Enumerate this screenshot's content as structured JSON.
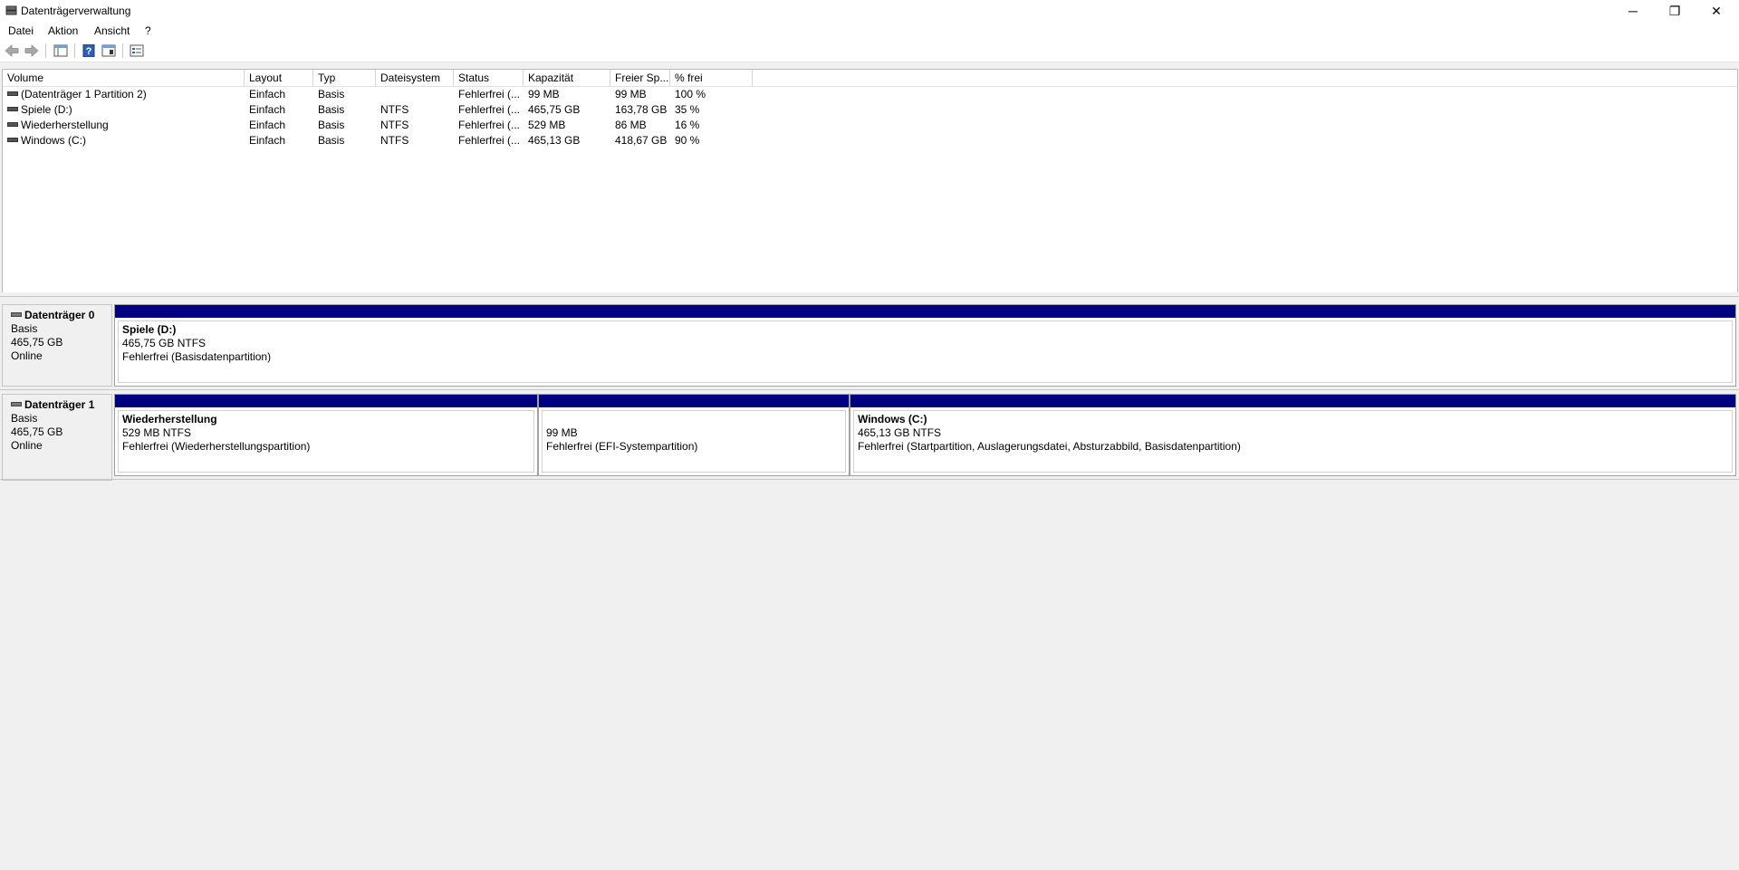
{
  "window": {
    "title": "Datenträgerverwaltung",
    "minimize_glyph": "─",
    "restore_glyph": "❐",
    "close_glyph": "✕"
  },
  "menu": [
    "Datei",
    "Aktion",
    "Ansicht",
    "?"
  ],
  "toolbar": {
    "icons": [
      "back-arrow-icon",
      "forward-arrow-icon",
      "console-tree-icon",
      "help-icon",
      "show-hide-icon",
      "properties-icon"
    ]
  },
  "volume_list": {
    "columns": [
      "Volume",
      "Layout",
      "Typ",
      "Dateisystem",
      "Status",
      "Kapazität",
      "Freier Sp...",
      "% frei"
    ],
    "rows": [
      [
        "(Datenträger 1 Partition 2)",
        "Einfach",
        "Basis",
        "",
        "Fehlerfrei (...",
        "99 MB",
        "99 MB",
        "100 %"
      ],
      [
        "Spiele (D:)",
        "Einfach",
        "Basis",
        "NTFS",
        "Fehlerfrei (...",
        "465,75 GB",
        "163,78 GB",
        "35 %"
      ],
      [
        "Wiederherstellung",
        "Einfach",
        "Basis",
        "NTFS",
        "Fehlerfrei (...",
        "529 MB",
        "86 MB",
        "16 %"
      ],
      [
        "Windows (C:)",
        "Einfach",
        "Basis",
        "NTFS",
        "Fehlerfrei (...",
        "465,13 GB",
        "418,67 GB",
        "90 %"
      ]
    ]
  },
  "disks": [
    {
      "name": "Datenträger 0",
      "type": "Basis",
      "size": "465,75 GB",
      "state": "Online",
      "partitions": [
        {
          "name": "Spiele  (D:)",
          "size": "465,75 GB NTFS",
          "status": "Fehlerfrei (Basisdatenpartition)"
        }
      ]
    },
    {
      "name": "Datenträger 1",
      "type": "Basis",
      "size": "465,75 GB",
      "state": "Online",
      "partitions": [
        {
          "name": "Wiederherstellung",
          "size": "529 MB NTFS",
          "status": "Fehlerfrei (Wiederherstellungspartition)"
        },
        {
          "name": "",
          "size": "99 MB",
          "status": "Fehlerfrei (EFI-Systempartition)"
        },
        {
          "name": "Windows  (C:)",
          "size": "465,13 GB NTFS",
          "status": "Fehlerfrei (Startpartition, Auslagerungsdatei, Absturzabbild, Basisdatenpartition)"
        }
      ]
    }
  ],
  "colors": {
    "partition_bar": "#000080",
    "background": "#f0f0f0"
  }
}
